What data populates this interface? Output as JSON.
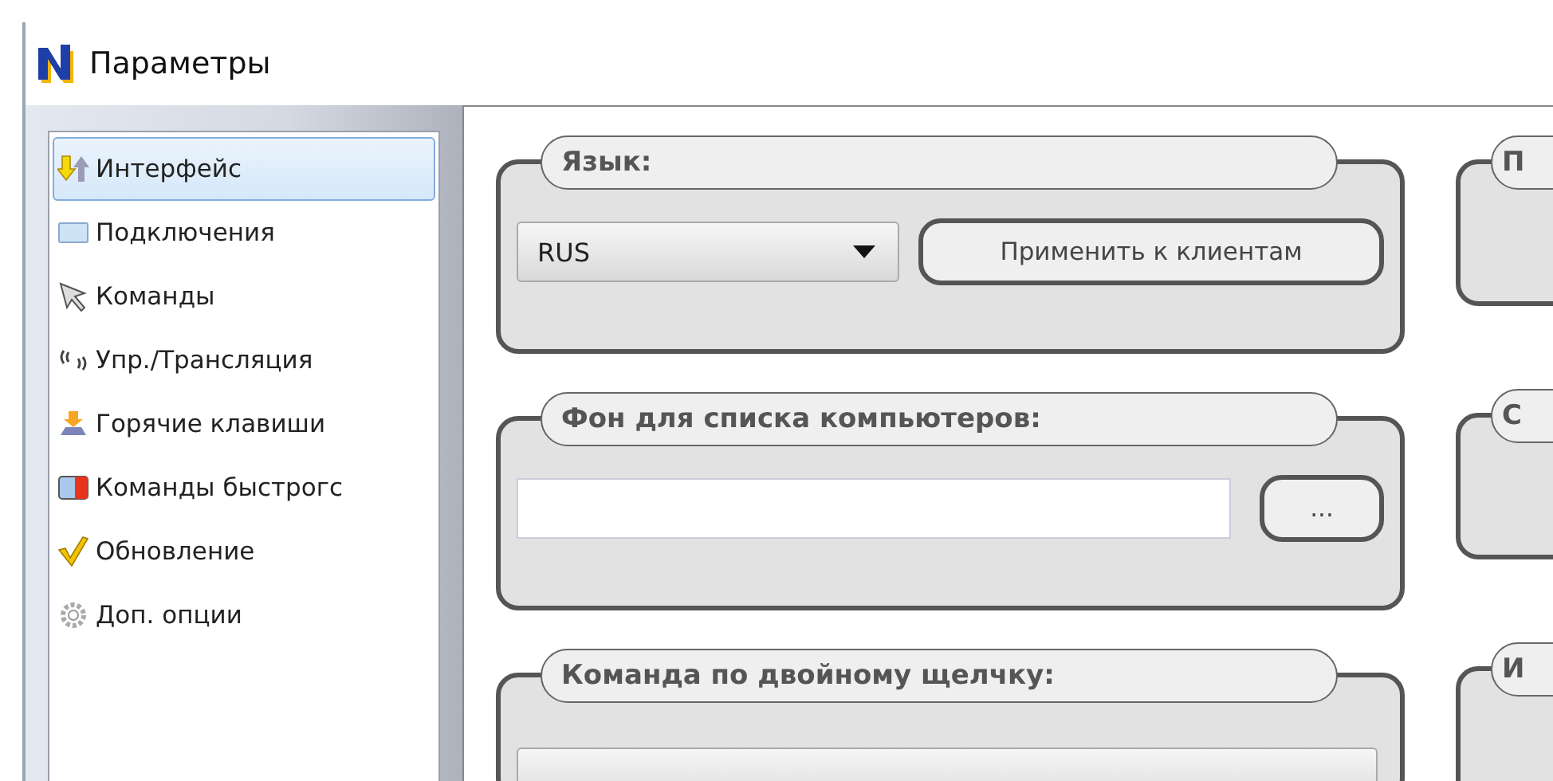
{
  "window": {
    "title": "Параметры"
  },
  "sidebar": {
    "items": [
      {
        "label": "Интерфейс",
        "selected": true
      },
      {
        "label": "Подключения",
        "selected": false
      },
      {
        "label": "Команды",
        "selected": false
      },
      {
        "label": "Упр./Трансляция",
        "selected": false
      },
      {
        "label": "Горячие клавиши",
        "selected": false
      },
      {
        "label": "Команды быстрогс",
        "selected": false
      },
      {
        "label": "Обновление",
        "selected": false
      },
      {
        "label": "Доп. опции",
        "selected": false
      }
    ]
  },
  "groups_left": [
    {
      "kind": "language",
      "title": "Язык:",
      "dropdown": {
        "value": "RUS"
      },
      "button": "Применить к клиентам"
    },
    {
      "kind": "file",
      "title": "Фон для списка компьютеров:",
      "button": "..."
    },
    {
      "kind": "command",
      "title": "Команда по двойному щелчку:"
    }
  ],
  "groups_right": [
    {
      "title": "П"
    },
    {
      "title": "С"
    },
    {
      "title": "И"
    }
  ]
}
